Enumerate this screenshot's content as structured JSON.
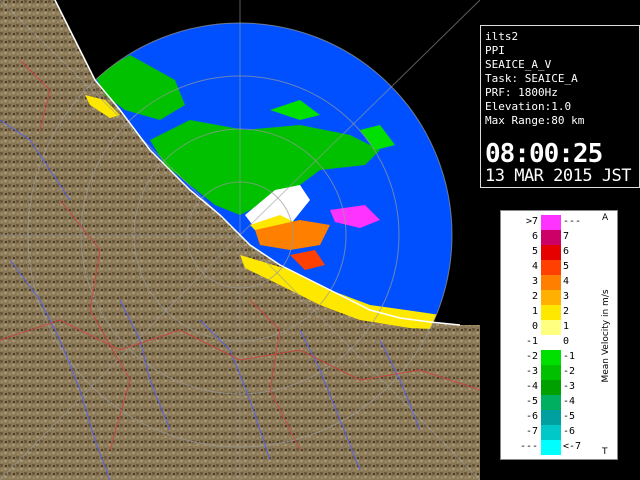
{
  "info": {
    "radar_name": "ilts2",
    "scan_type": "PPI",
    "product": "SEAICE_A_V",
    "task": "Task: SEAICE_A",
    "prf": "PRF: 1800Hz",
    "elevation": "Elevation:1.0",
    "max_range": "Max Range:80 km",
    "time": "08:00:25",
    "date": "13 MAR 2015 JST"
  },
  "legend": {
    "title": "Mean Velocity in m/s",
    "top_mark": "A",
    "bottom_mark": "T",
    "rows": [
      {
        "left": ">7",
        "right": "---",
        "color": "#ff33ff"
      },
      {
        "left": "6",
        "right": "7",
        "color": "#cc0066"
      },
      {
        "left": "5",
        "right": "6",
        "color": "#e60000"
      },
      {
        "left": "4",
        "right": "5",
        "color": "#ff4000"
      },
      {
        "left": "3",
        "right": "4",
        "color": "#ff7f00"
      },
      {
        "left": "2",
        "right": "3",
        "color": "#ffb000"
      },
      {
        "left": "1",
        "right": "2",
        "color": "#ffe800"
      },
      {
        "left": "0",
        "right": "1",
        "color": "#ffff80"
      },
      {
        "left": "-1",
        "right": "0",
        "color": "#ffffff"
      },
      {
        "left": "-2",
        "right": "-1",
        "color": "#00e000"
      },
      {
        "left": "-3",
        "right": "-2",
        "color": "#00c000"
      },
      {
        "left": "-4",
        "right": "-3",
        "color": "#00a000"
      },
      {
        "left": "-5",
        "right": "-4",
        "color": "#00b060"
      },
      {
        "left": "-6",
        "right": "-5",
        "color": "#00a0a0"
      },
      {
        "left": "-7",
        "right": "-6",
        "color": "#00c8c8"
      },
      {
        "left": "---",
        "right": "<-7",
        "color": "#00ffff"
      }
    ]
  },
  "colors": {
    "terrain": "#8a7a5a",
    "terrain_dark": "#5a4a30",
    "ocean_echo": "#0050ff",
    "range_ring": "#9a9a9a",
    "coast": "#ffffff"
  }
}
